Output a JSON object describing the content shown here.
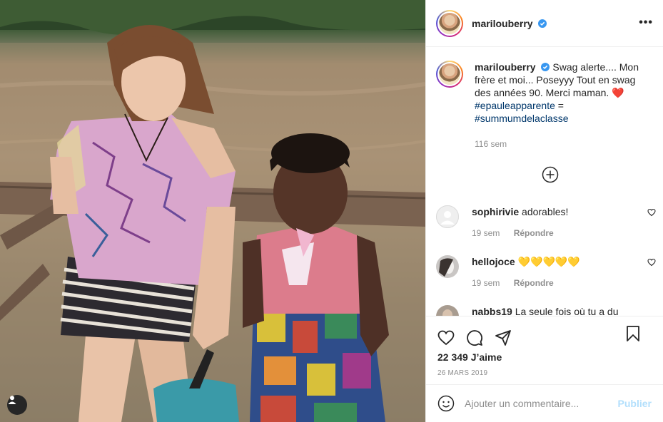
{
  "post": {
    "author": "marilouberry",
    "caption_text": "Swag alerte.... Mon frère et moi... Poseyyy Tout en swag des années 90. Merci maman. ❤️",
    "hashtag_1": "#epauleapparente",
    "equals": "=",
    "hashtag_2": "#summumdelaclasse",
    "caption_time": "116 sem",
    "likes": "22 349 J’aime",
    "date": "26 MARS 2019"
  },
  "comments": [
    {
      "user": "sophirivie",
      "text": "adorables!",
      "time": "19 sem",
      "reply": "Répondre"
    },
    {
      "user": "hellojoce",
      "text": "💛💛💛💛💛",
      "time": "19 sem",
      "reply": "Répondre"
    },
    {
      "user": "nabbs19",
      "text": "La seule fois où tu a du"
    }
  ],
  "composer": {
    "placeholder": "Ajouter un commentaire...",
    "post_label": "Publier"
  },
  "icons": {
    "header_more": "more-horizontal-icon",
    "verified": "verified-badge-icon",
    "load_more": "plus-circle-icon",
    "like": "heart-icon",
    "comment": "comment-bubble-icon",
    "share": "paper-plane-icon",
    "save": "bookmark-icon",
    "emoji": "emoji-icon",
    "user_tags": "user-tag-icon"
  },
  "colors": {
    "link": "#00376b",
    "verified": "#3897f0",
    "post_button_disabled": "#b2dffc",
    "muted": "#8e8e8e"
  }
}
